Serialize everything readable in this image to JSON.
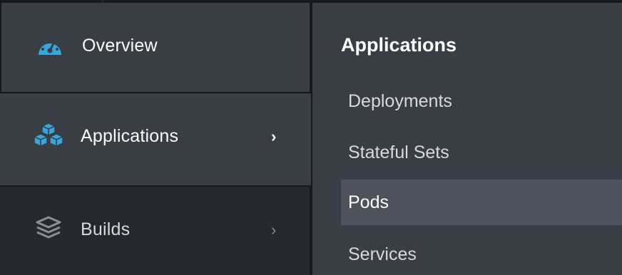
{
  "nav": {
    "items": [
      {
        "label": "Overview",
        "icon": "dashboard-gauge-icon",
        "icon_color": "#39a5dc"
      },
      {
        "label": "Applications",
        "icon": "cubes-icon",
        "icon_color": "#39a5dc",
        "chevron": "›"
      },
      {
        "label": "Builds",
        "icon": "layers-icon",
        "icon_color": "#8a8d91",
        "chevron": "›"
      }
    ]
  },
  "secondary": {
    "title": "Applications",
    "items": [
      {
        "label": "Deployments"
      },
      {
        "label": "Stateful Sets"
      },
      {
        "label": "Pods",
        "active": true
      },
      {
        "label": "Services"
      }
    ]
  },
  "colors": {
    "accent": "#39a5dc",
    "nav_bg": "#393d44",
    "nav_dark_bg": "#25282c",
    "active_bg": "#4d525b"
  }
}
